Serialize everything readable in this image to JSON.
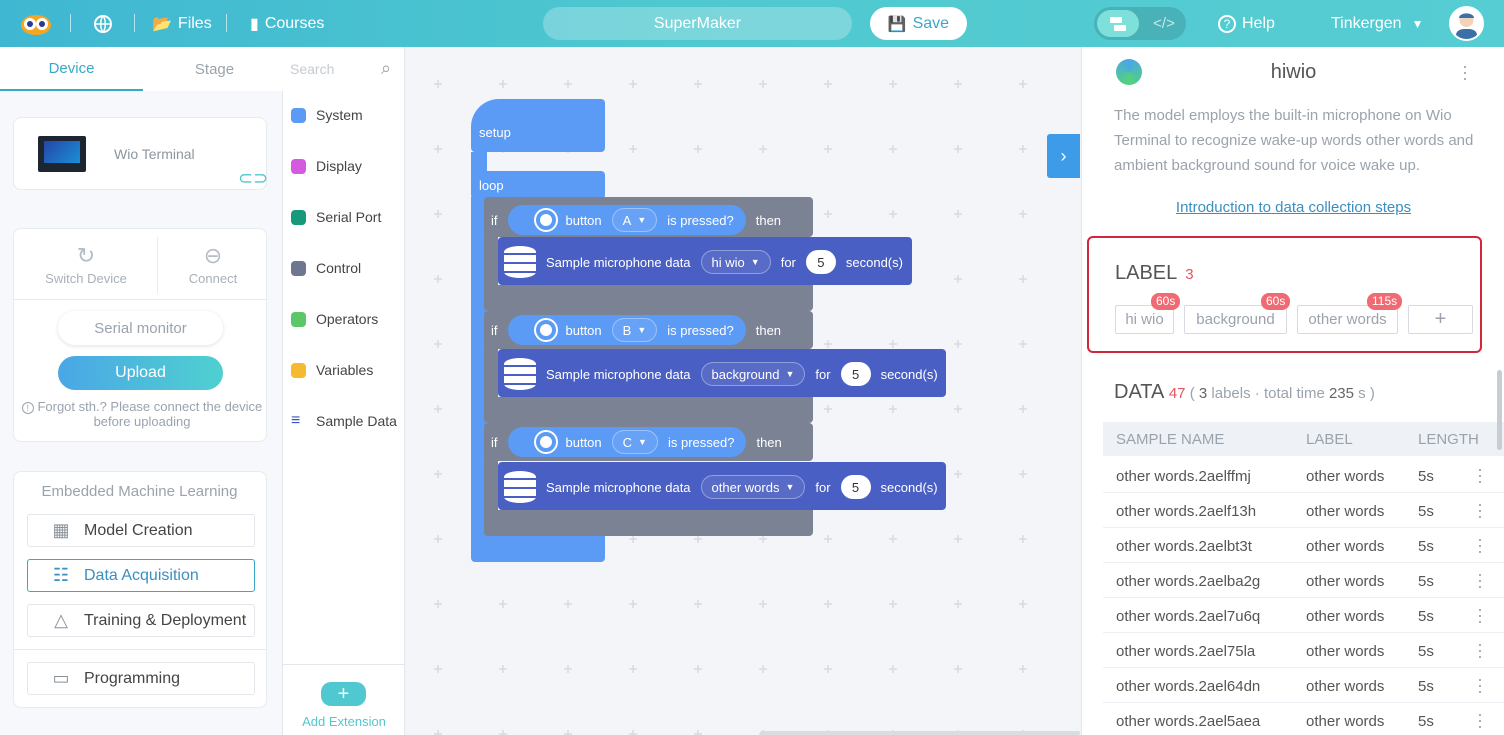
{
  "topbar": {
    "files": "Files",
    "courses": "Courses",
    "project_name": "SuperMaker",
    "save": "Save",
    "help": "Help",
    "user": "Tinkergen"
  },
  "left": {
    "tabs": [
      "Device",
      "Stage"
    ],
    "device_name": "Wio Terminal",
    "switch_device": "Switch Device",
    "connect": "Connect",
    "serial_monitor": "Serial monitor",
    "upload": "Upload",
    "hint": "Forgot sth.? Please connect the device before uploading",
    "eml_title": "Embedded Machine Learning",
    "menu": [
      "Model Creation",
      "Data Acquisition",
      "Training & Deployment",
      "Programming"
    ]
  },
  "categories": {
    "search_placeholder": "Search",
    "items": [
      {
        "label": "System",
        "color": "#5b9bf6"
      },
      {
        "label": "Display",
        "color": "#d45bdf"
      },
      {
        "label": "Serial Port",
        "color": "#179a7a"
      },
      {
        "label": "Control",
        "color": "#6f7690"
      },
      {
        "label": "Operators",
        "color": "#5bc766"
      },
      {
        "label": "Variables",
        "color": "#f5b932"
      },
      {
        "label": "Sample Data",
        "color": "#3c55c4"
      }
    ],
    "add_extension": "Add Extension"
  },
  "blocks": {
    "setup": "setup",
    "loop": "loop",
    "if": "if",
    "button": "button",
    "is_pressed": "is pressed?",
    "then": "then",
    "sample": "Sample microphone data",
    "for": "for",
    "seconds": "second(s)",
    "rows": [
      {
        "button": "A",
        "label": "hi wio",
        "secs": "5"
      },
      {
        "button": "B",
        "label": "background",
        "secs": "5"
      },
      {
        "button": "C",
        "label": "other words",
        "secs": "5"
      }
    ]
  },
  "right": {
    "title": "hiwio",
    "description": "The model employs the built-in microphone on Wio Terminal to recognize wake-up words other words and ambient background sound for voice wake up.",
    "intro_link": "Introduction to data collection steps",
    "label_title": "LABEL",
    "label_count": "3",
    "labels": [
      {
        "name": "hi wio",
        "time": "60s"
      },
      {
        "name": "background",
        "time": "60s"
      },
      {
        "name": "other words",
        "time": "115s"
      }
    ],
    "add_label": "+",
    "data_title": "DATA",
    "data_count": "47",
    "data_paren_open": "(",
    "data_label_count": "3",
    "data_labels_word": "labels",
    "data_dot": "·",
    "data_total_time_word": "total time",
    "data_total": "235",
    "data_unit": "s",
    "data_paren_close": ")",
    "columns": [
      "SAMPLE NAME",
      "LABEL",
      "LENGTH"
    ],
    "rows": [
      {
        "name": "other words.2aelffmj",
        "label": "other words",
        "length": "5s"
      },
      {
        "name": "other words.2aelf13h",
        "label": "other words",
        "length": "5s"
      },
      {
        "name": "other words.2aelbt3t",
        "label": "other words",
        "length": "5s"
      },
      {
        "name": "other words.2aelba2g",
        "label": "other words",
        "length": "5s"
      },
      {
        "name": "other words.2ael7u6q",
        "label": "other words",
        "length": "5s"
      },
      {
        "name": "other words.2ael75la",
        "label": "other words",
        "length": "5s"
      },
      {
        "name": "other words.2ael64dn",
        "label": "other words",
        "length": "5s"
      },
      {
        "name": "other words.2ael5aea",
        "label": "other words",
        "length": "5s"
      }
    ]
  }
}
